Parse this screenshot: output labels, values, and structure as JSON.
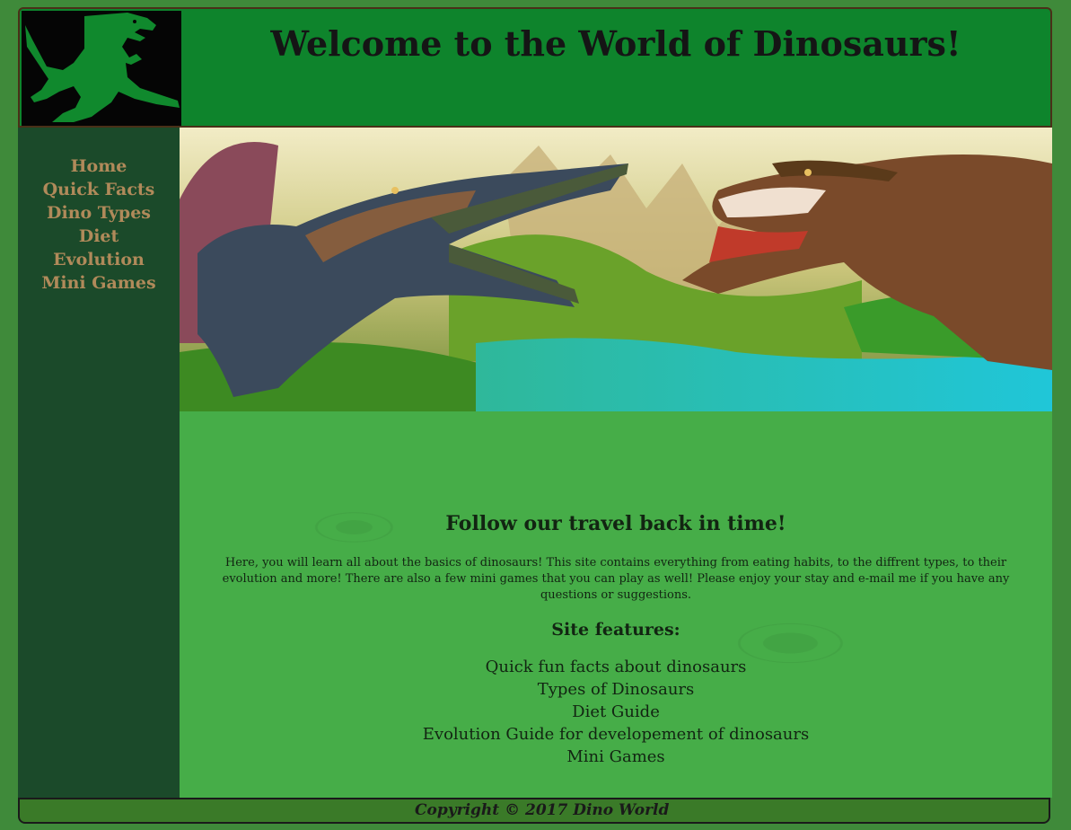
{
  "header": {
    "title": "Welcome to the World of Dinosaurs!",
    "logo_icon": "t-rex-silhouette-icon"
  },
  "sidebar": {
    "items": [
      {
        "label": "Home"
      },
      {
        "label": "Quick Facts"
      },
      {
        "label": "Dino Types"
      },
      {
        "label": "Diet"
      },
      {
        "label": "Evolution"
      },
      {
        "label": "Mini Games"
      }
    ]
  },
  "main": {
    "heading": "Follow our travel back in time!",
    "intro": "Here, you will learn all about the basics of dinosaurs! This site contains everything from eating habits, to the diffrent types, to their evolution and more! There are also a few mini games that you can play as well! Please enjoy your stay and e-mail me if you have any questions or suggestions.",
    "features_heading": "Site features:",
    "features": [
      "Quick fun facts about dinosaurs",
      "Types of Dinosaurs",
      "Diet Guide",
      "Evolution Guide for developement of dinosaurs",
      "Mini Games"
    ]
  },
  "footer": {
    "copyright": "Copyright © 2017 Dino World"
  },
  "colors": {
    "header_bg": "#0e842c",
    "sidebar_bg": "#1b4a2a",
    "nav_text": "#b08a5a",
    "content_bg": "#46ad48",
    "footer_bg": "#3a7a28"
  }
}
